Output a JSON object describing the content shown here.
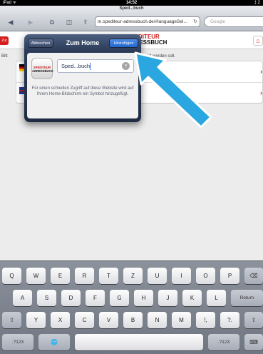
{
  "status_bar": {
    "carrier": "iPad ᯤ",
    "time": "14:52",
    "battery": "‡ 2"
  },
  "browser": {
    "page_title": "Sped...buch",
    "address": "m.spediteur-adressbuch.de/#languageSel...",
    "search_placeholder": "Google",
    "icons": [
      "back-icon",
      "forward-icon",
      "tabs-icon",
      "bookmarks-icon",
      "share-icon",
      "reload-icon"
    ]
  },
  "page": {
    "back_label": "Zur",
    "logo_line1": "SPEDITEUR",
    "logo_line2": "ADRESSBUCH",
    "left_text": "Bitt",
    "right_text": "hlt werden soll.",
    "languages": [
      {
        "flag": "de",
        "remove_label": "›"
      },
      {
        "flag": "uk",
        "remove_label": "›"
      }
    ]
  },
  "popover": {
    "cancel_label": "Abbrechen",
    "title": "Zum Home",
    "add_label": "Hinzufügen",
    "icon_line1": "SPEDITEUR",
    "icon_line2": "ADRESSBUCH",
    "name_value": "Sped...buch",
    "hint": "Für einen schnellen Zugriff auf diese Website wird auf Ihrem Home-Bildschirm ein Symbol hinzugefügt."
  },
  "keyboard": {
    "row1": [
      "Q",
      "W",
      "E",
      "R",
      "T",
      "Z",
      "U",
      "I",
      "O",
      "P",
      "⌫"
    ],
    "row2": [
      "A",
      "S",
      "D",
      "F",
      "G",
      "H",
      "J",
      "K",
      "L",
      "Return"
    ],
    "row3": [
      "⇧",
      "Y",
      "X",
      "C",
      "V",
      "B",
      "N",
      "M",
      "!,",
      "?.",
      "⇧"
    ],
    "row4": [
      ".?123",
      "🌐",
      "",
      ".?123",
      "⌨"
    ]
  },
  "colors": {
    "accent": "#2266cf",
    "brand_red": "#c81e1e",
    "annotation_arrow": "#2aa7e0"
  }
}
